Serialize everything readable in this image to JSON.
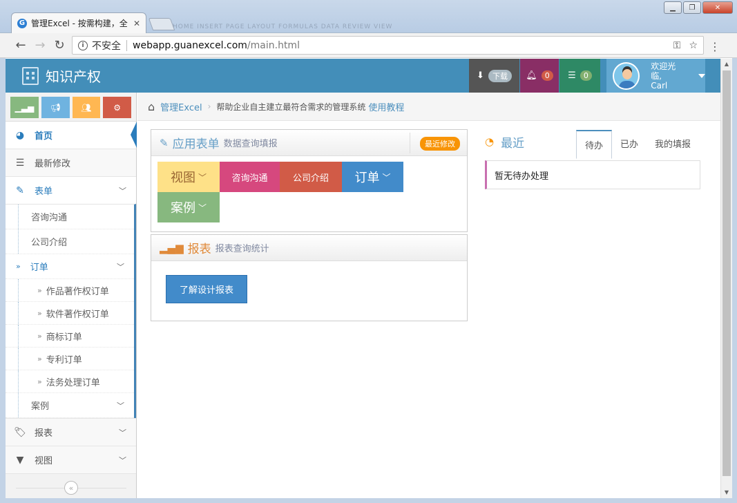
{
  "browser": {
    "tab_title": "管理Excel - 按需构建，全",
    "favicon": "G",
    "tab_close": "✕",
    "security_label": "不安全",
    "url_host": "webapp.guanexcel.com",
    "url_path": "/main.html",
    "ghost_ribbon": "HOME   INSERT   PAGE LAYOUT   FORMULAS   DATA   REVIEW   VIEW"
  },
  "navbar": {
    "brand": "知识产权",
    "download_label": "下载",
    "notifications_count": "0",
    "tasks_count": "0",
    "welcome": "欢迎光临,",
    "username": "Carl"
  },
  "sidebar": {
    "items": [
      {
        "label": "首页",
        "icon": "dashboard-icon"
      },
      {
        "label": "最新修改",
        "icon": "list-icon"
      },
      {
        "label": "表单",
        "icon": "edit-icon"
      },
      {
        "label": "报表",
        "icon": "tag-icon"
      },
      {
        "label": "视图",
        "icon": "filter-icon"
      }
    ],
    "form_children": [
      "咨询沟通",
      "公司介绍",
      "订单",
      "案例"
    ],
    "order_children": [
      "作品著作权订单",
      "软件著作权订单",
      "商标订单",
      "专利订单",
      "法务处理订单"
    ],
    "collapse_glyph": "«"
  },
  "breadcrumb": {
    "home": "管理Excel",
    "description": "帮助企业自主建立最符合需求的管理系统",
    "tutorial_link": "使用教程"
  },
  "forms_widget": {
    "title": "应用表单",
    "subtitle": "数据查询填报",
    "recent_tag": "最近修改",
    "tiles": [
      "视图",
      "咨询沟通",
      "公司介绍",
      "订单",
      "案例"
    ]
  },
  "reports_widget": {
    "title": "报表",
    "subtitle": "报表查询统计",
    "button": "了解设计报表"
  },
  "recent_panel": {
    "title": "最近",
    "tabs": [
      "待办",
      "已办",
      "我的填报"
    ],
    "empty_text": "暂无待办处理"
  }
}
